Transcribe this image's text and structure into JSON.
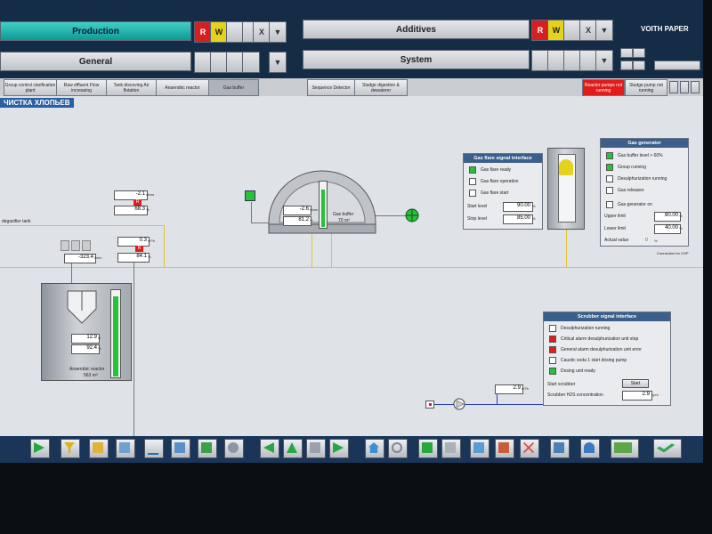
{
  "top_nav": {
    "production": "Production",
    "additives": "Additives",
    "general": "General",
    "system": "System",
    "alarm_r": "R",
    "alarm_w": "W",
    "x": "X",
    "brand": "VOITH PAPER"
  },
  "tabs": [
    "Group control clarification plant",
    "Raw effluent Flow increasing",
    "Tank discoving Air flotation",
    "Anaerobic reactor",
    "Gas buffer",
    "Sequence Detector",
    "Sludge digestion & dewaterer",
    "Reactor pumps not running",
    "Sludge pump not running"
  ],
  "page_title": "ЧИСТКА ХЛОПЬЕВ",
  "left_label": "degasifier tank",
  "readouts": {
    "r1": {
      "value": "-2.1",
      "unit": "mbar"
    },
    "r2": {
      "value": "68.3",
      "unit": "%"
    },
    "r3": {
      "value": "0.3",
      "unit": "m³/h"
    },
    "r4": {
      "value": "-323.4",
      "unit": "l/min"
    },
    "r5": {
      "value": "84.1",
      "unit": "%"
    },
    "r6": {
      "value": "12.9",
      "unit": "m"
    },
    "r7": {
      "value": "92.4",
      "unit": "%"
    },
    "r8": {
      "value": "-2.6",
      "unit": "mbar"
    },
    "r9": {
      "value": "81.2",
      "unit": "%"
    },
    "r10": {
      "value": "2.9",
      "unit": "m³/h"
    }
  },
  "gas_buffer_label": "Gas buffer",
  "gas_buffer_volume": "70 m³",
  "reactor_label": "Anaerobic reactor",
  "reactor_volume": "563 m³",
  "gas_flare": {
    "title": "Gas flare signal interface",
    "rows": [
      "Gas flare ready",
      "Gas flare operation",
      "Gas flare start"
    ],
    "start_level_label": "Start level",
    "start_level": "90.00",
    "stop_level_label": "Stop level",
    "stop_level": "85.00",
    "unit": "%"
  },
  "gas_generator": {
    "title": "Gas generator",
    "rows": [
      "Gas buffer level > 60%",
      "Group running",
      "Desulphurization running",
      "Gas releases"
    ],
    "gen_on": "Gas generator on",
    "upper_limit_label": "Upper limit",
    "upper_limit": "80.00",
    "lower_limit_label": "Lower limit",
    "lower_limit": "40.00",
    "actual_label": "Actual value",
    "actual_value": "0",
    "unit": "%"
  },
  "right_note": "Connection for CHP",
  "scrubber": {
    "title": "Scrubber signal interface",
    "rows": [
      "Desulphurization running",
      "Critical alarm desulphurization unit stop",
      "General alarm desulphurization unit error",
      "Caustic soda 1 start dosing pump",
      "Dosing unit ready"
    ],
    "start_label": "Start scrubber",
    "start_btn": "Start",
    "h2s_label": "Scrubber H2S concentration",
    "h2s_value": "2.9",
    "h2s_unit": "ppm"
  },
  "colors": {
    "accent": "#2a5fa0",
    "ok": "#27c13b",
    "alarm": "#e21b1b",
    "pipe": "#e3c431"
  }
}
